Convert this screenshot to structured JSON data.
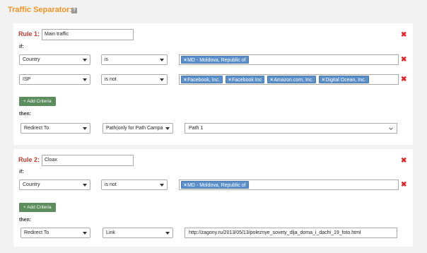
{
  "header": {
    "title": "Traffic Separator:",
    "help_glyph": "?"
  },
  "rules": [
    {
      "label": "Rule 1:",
      "name": "Main traffic",
      "if_label": "if:",
      "criteria": [
        {
          "field": "Country",
          "operator": "is",
          "tags": [
            "MD - Moldova, Republic of"
          ]
        },
        {
          "field": "ISP",
          "operator": "is not",
          "tags": [
            "Facebook, Inc.",
            "Facebook Inc",
            "Amazon.com, Inc.",
            "Digital Ocean, Inc."
          ]
        }
      ],
      "add_label": "+ Add Criteria",
      "then_label": "then:",
      "action": "Redirect To",
      "target_type": "Path(only for Path Campa",
      "target_value": "Path 1"
    },
    {
      "label": "Rule 2:",
      "name": "Cloax",
      "if_label": "if:",
      "criteria": [
        {
          "field": "Country",
          "operator": "is not",
          "tags": [
            "MD - Moldova, Republic of"
          ]
        }
      ],
      "add_label": "+ Add Criteria",
      "then_label": "then:",
      "action": "Redirect To",
      "target_type": "Link",
      "target_value": "http://zagony.ru/2013/05/13/poleznye_sovety_dlja_doma_i_dachi_19_foto.html"
    }
  ],
  "tag_remove_glyph": "×",
  "delete_glyph": "✖",
  "colors": {
    "accent": "#f29424",
    "rule_label": "#c0392b",
    "tag": "#5b8fc9",
    "add_button": "#5c8d5c",
    "delete": "#d9262b"
  }
}
